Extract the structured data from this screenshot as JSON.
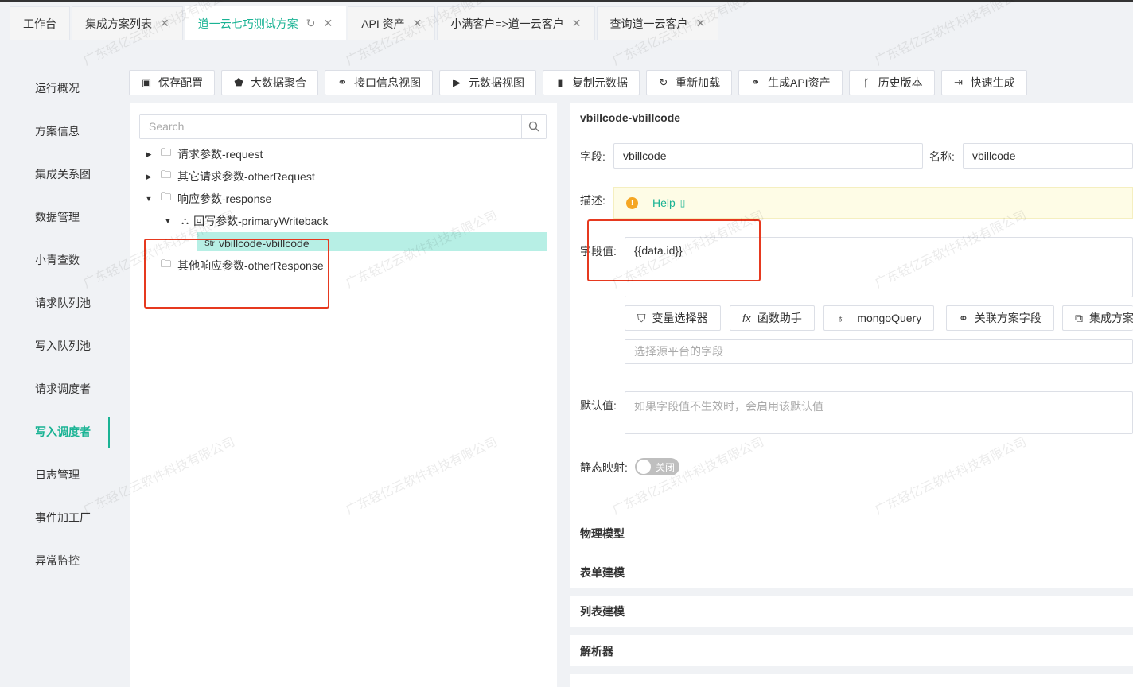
{
  "tabs": [
    {
      "label": "工作台",
      "closable": false,
      "active": false
    },
    {
      "label": "集成方案列表",
      "closable": true,
      "active": false
    },
    {
      "label": "道一云七巧测试方案",
      "closable": true,
      "active": true
    },
    {
      "label": "API 资产",
      "closable": true,
      "active": false
    },
    {
      "label": "小满客户=>道一云客户",
      "closable": true,
      "active": false
    },
    {
      "label": "查询道一云客户",
      "closable": true,
      "active": false
    }
  ],
  "sidebar": {
    "items": [
      {
        "label": "运行概况"
      },
      {
        "label": "方案信息"
      },
      {
        "label": "集成关系图"
      },
      {
        "label": "数据管理"
      },
      {
        "label": "小青查数"
      },
      {
        "label": "请求队列池"
      },
      {
        "label": "写入队列池"
      },
      {
        "label": "请求调度者"
      },
      {
        "label": "写入调度者",
        "active": true
      },
      {
        "label": "日志管理"
      },
      {
        "label": "事件加工厂"
      },
      {
        "label": "异常监控"
      }
    ]
  },
  "toolbar": {
    "buttons": [
      {
        "label": "保存配置",
        "icon": "save-icon"
      },
      {
        "label": "大数据聚合",
        "icon": "pentagon-icon"
      },
      {
        "label": "接口信息视图",
        "icon": "link-icon"
      },
      {
        "label": "元数据视图",
        "icon": "terminal-icon"
      },
      {
        "label": "复制元数据",
        "icon": "copy-icon"
      },
      {
        "label": "重新加载",
        "icon": "reload-icon"
      },
      {
        "label": "生成API资产",
        "icon": "link-icon"
      },
      {
        "label": "历史版本",
        "icon": "branch-icon"
      },
      {
        "label": "快速生成",
        "icon": "export-icon"
      }
    ]
  },
  "tree": {
    "search_placeholder": "Search",
    "nodes": [
      {
        "label": "请求参数-request"
      },
      {
        "label": "其它请求参数-otherRequest"
      },
      {
        "label": "响应参数-response"
      },
      {
        "label": "回写参数-primaryWriteback"
      },
      {
        "label": "vbillcode-vbillcode",
        "type_tag": "Str"
      },
      {
        "label": "其他响应参数-otherResponse"
      }
    ]
  },
  "detail": {
    "title": "vbillcode-vbillcode",
    "field_label": "字段:",
    "field_value": "vbillcode",
    "name_label": "名称:",
    "name_value": "vbillcode",
    "desc_label": "描述:",
    "help_text": "Help",
    "value_label": "字段值:",
    "value_text": "{{data.id}}",
    "helper_buttons": [
      {
        "label": "变量选择器",
        "icon": "filter-icon"
      },
      {
        "label": "函数助手",
        "icon": "fx-icon"
      },
      {
        "label": "_mongoQuery",
        "icon": "bulb-icon"
      },
      {
        "label": "关联方案字段",
        "icon": "link-icon"
      },
      {
        "label": "集成方案",
        "icon": "cluster-icon"
      }
    ],
    "source_placeholder": "选择源平台的字段",
    "default_label": "默认值:",
    "default_placeholder": "如果字段值不生效时，会启用该默认值",
    "static_label": "静态映射:",
    "toggle_text": "关闭"
  },
  "sections": [
    {
      "label": "物理模型"
    },
    {
      "label": "表单建模"
    },
    {
      "label": "列表建模"
    },
    {
      "label": "解析器"
    }
  ],
  "watermark": "广东轻亿云软件科技有限公司",
  "colors": {
    "accent": "#1ab394",
    "highlight": "#e6391f",
    "selected_row": "#b7efe5"
  }
}
